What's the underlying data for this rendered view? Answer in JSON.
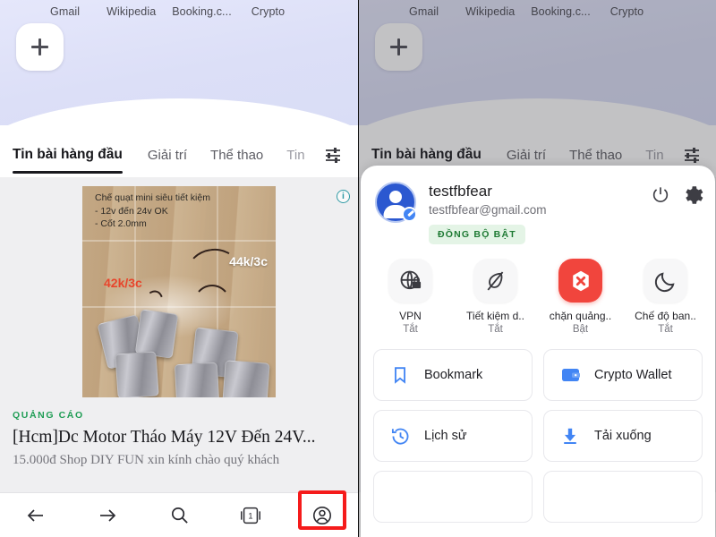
{
  "shortcuts": [
    "Gmail",
    "Wikipedia",
    "Booking.c...",
    "Crypto"
  ],
  "add_tile": {
    "name": "add-shortcut",
    "glyph": "+"
  },
  "tabs": [
    {
      "label": "Tin bài hàng đầu",
      "active": true
    },
    {
      "label": "Giải trí",
      "active": false
    },
    {
      "label": "Thể thao",
      "active": false
    },
    {
      "label": "Tin",
      "active": false
    }
  ],
  "tab_filter_icon": "sliders-icon",
  "feed": {
    "info_badge": "i",
    "ad_image": {
      "caption_line1": "Chế quạt mini siêu tiết kiệm",
      "caption_line2": "- 12v đến 24v OK",
      "caption_line3": "- Cốt 2.0mm",
      "price_white": "44k/3c",
      "price_red": "42k/3c"
    },
    "ad_label": "QUẢNG CÁO",
    "ad_title": "[Hcm]Dc Motor Tháo Máy 12V Đến 24V...",
    "ad_desc": "15.000đ Shop DIY FUN xin kính chào quý khách"
  },
  "bottom_nav": [
    {
      "name": "back-icon",
      "label": "back"
    },
    {
      "name": "forward-icon",
      "label": "forward"
    },
    {
      "name": "search-icon",
      "label": "search"
    },
    {
      "name": "tabs-icon",
      "label": "tabs",
      "count": "1"
    },
    {
      "name": "profile-icon",
      "label": "profile"
    }
  ],
  "account": {
    "name": "testfbfear",
    "email": "testfbfear@gmail.com",
    "sync_badge": "ĐỒNG BỘ BẬT",
    "power_icon": "power-icon",
    "settings_icon": "gear-icon"
  },
  "quick_actions": [
    {
      "label": "VPN",
      "state": "Tắt",
      "icon": "vpn-globe-lock-icon",
      "on": false
    },
    {
      "label": "Tiết kiệm d..",
      "state": "Tắt",
      "icon": "leaf-icon",
      "on": false
    },
    {
      "label": "chặn quảng..",
      "state": "Bật",
      "icon": "adblock-shield-icon",
      "on": true
    },
    {
      "label": "Chế độ ban..",
      "state": "Tắt",
      "icon": "moon-icon",
      "on": false
    }
  ],
  "menu_items": [
    {
      "label": "Bookmark",
      "icon": "bookmark-icon"
    },
    {
      "label": "Crypto Wallet",
      "icon": "wallet-icon"
    },
    {
      "label": "Lịch sử",
      "icon": "history-icon"
    },
    {
      "label": "Tải xuống",
      "icon": "download-icon"
    }
  ],
  "colors": {
    "accent_blue": "#4285f4",
    "highlight_red": "#f51b1b",
    "adblock_red": "#f1453d",
    "sync_green": "#1e7a33",
    "ad_label_green": "#1f9d55"
  }
}
